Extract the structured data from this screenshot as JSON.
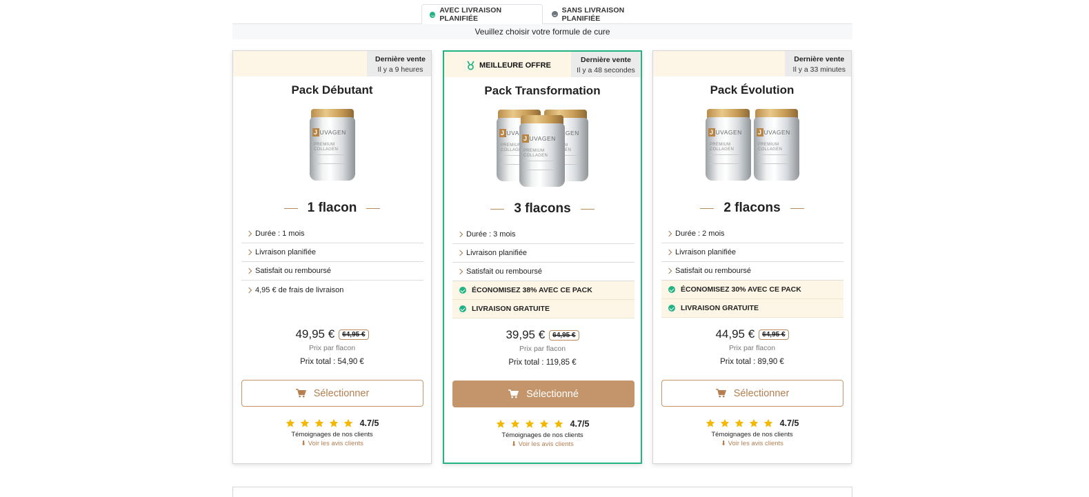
{
  "tabs": [
    {
      "label": "AVEC LIVRAISON PLANIFIÉE",
      "active": true
    },
    {
      "label": "SANS LIVRAISON PLANIFIÉE",
      "active": false
    }
  ],
  "subtitle": "Veuillez choisir votre formule de cure",
  "cards": [
    {
      "last_sale_title": "Dernière vente",
      "last_sale_time": "Il y a 9 heures",
      "title": "Pack Débutant",
      "quantity": "1 flacon",
      "features": [
        "Durée : 1 mois",
        "Livraison planifiée",
        "Satisfait ou remboursé",
        "4,95 € de frais de livraison"
      ],
      "price": "49,95 €",
      "old_price": "64,95 €",
      "per_label": "Prix par flacon",
      "total": "Prix total : 54,90 €",
      "button": "Sélectionner",
      "rating": "4.7/5",
      "testimonials": "Témoignages de nos clients",
      "see_reviews": "⬇ Voir les avis clients"
    },
    {
      "badge": "MEILLEURE OFFRE",
      "last_sale_title": "Dernière vente",
      "last_sale_time": "Il y a 48 secondes",
      "title": "Pack Transformation",
      "quantity": "3 flacons",
      "features": [
        "Durée : 3 mois",
        "Livraison planifiée",
        "Satisfait ou remboursé"
      ],
      "highlights": [
        "ÉCONOMISEZ 38% AVEC CE PACK",
        "LIVRAISON GRATUITE"
      ],
      "price": "39,95 €",
      "old_price": "64,95 €",
      "per_label": "Prix par flacon",
      "total": "Prix total : 119,85 €",
      "button": "Sélectionné",
      "rating": "4.7/5",
      "testimonials": "Témoignages de nos clients",
      "see_reviews": "⬇ Voir les avis clients"
    },
    {
      "last_sale_title": "Dernière vente",
      "last_sale_time": "Il y a 33 minutes",
      "title": "Pack Évolution",
      "quantity": "2 flacons",
      "features": [
        "Durée : 2 mois",
        "Livraison planifiée",
        "Satisfait ou remboursé"
      ],
      "highlights": [
        "ÉCONOMISEZ 30% AVEC CE PACK",
        "LIVRAISON GRATUITE"
      ],
      "price": "44,95 €",
      "old_price": "64,95 €",
      "per_label": "Prix par flacon",
      "total": "Prix total : 89,90 €",
      "button": "Sélectionner",
      "rating": "4.7/5",
      "testimonials": "Témoignages de nos clients",
      "see_reviews": "⬇ Voir les avis clients"
    }
  ],
  "product": {
    "brand_initial": "J",
    "brand_rest": "UVAGEN",
    "line1": "PREMIUM",
    "line2": "COLLAGEN"
  },
  "colors": {
    "accent": "#c4956b",
    "green": "#22b384",
    "highlight_bg": "#fdf6e6",
    "star": "#f5b800"
  }
}
